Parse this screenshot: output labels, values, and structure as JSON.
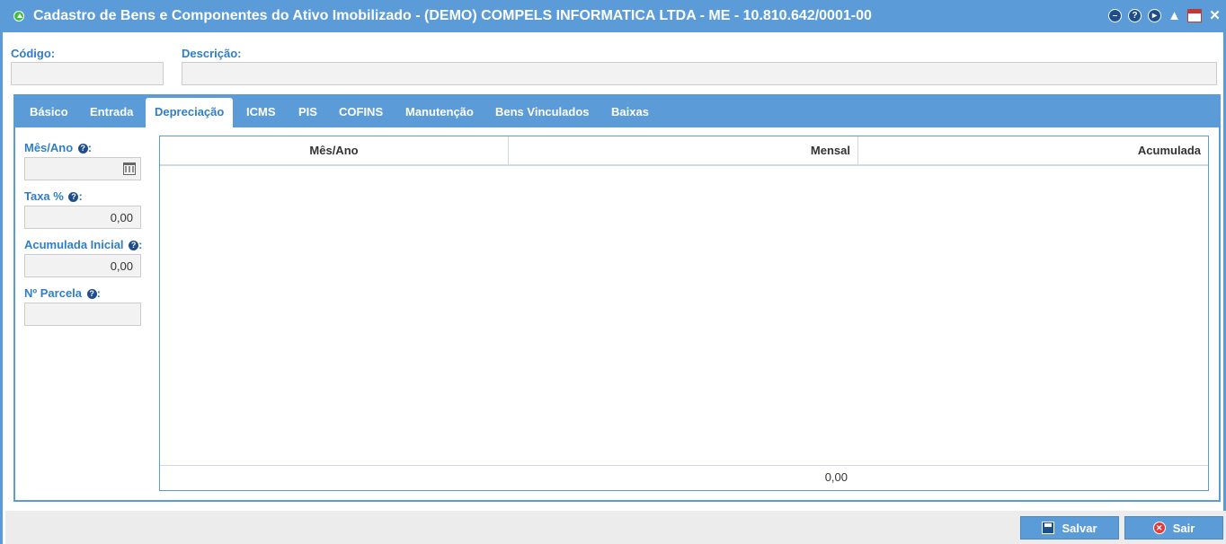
{
  "window": {
    "title": "Cadastro de Bens e Componentes do Ativo Imobilizado - (DEMO) COMPELS INFORMATICA LTDA - ME - 10.810.642/0001-00",
    "accent_color": "#5b9bd8"
  },
  "toolbar_icons": [
    "minimize-icon",
    "help-icon",
    "next-icon",
    "bell-icon",
    "calendar-icon",
    "close-icon"
  ],
  "header": {
    "codigo_label": "Código:",
    "codigo_value": "",
    "descricao_label": "Descrição:",
    "descricao_value": ""
  },
  "tabs": [
    {
      "label": "Básico",
      "active": false
    },
    {
      "label": "Entrada",
      "active": false
    },
    {
      "label": "Depreciação",
      "active": true
    },
    {
      "label": "ICMS",
      "active": false
    },
    {
      "label": "PIS",
      "active": false
    },
    {
      "label": "COFINS",
      "active": false
    },
    {
      "label": "Manutenção",
      "active": false
    },
    {
      "label": "Bens Vinculados",
      "active": false
    },
    {
      "label": "Baixas",
      "active": false
    }
  ],
  "depreciacao": {
    "mes_ano_label": "Mês/Ano",
    "mes_ano_value": "",
    "taxa_label": "Taxa %",
    "taxa_value": "0,00",
    "acumulada_inicial_label": "Acumulada Inicial",
    "acumulada_inicial_value": "0,00",
    "parcela_label": "Nº Parcela",
    "parcela_value": "",
    "help_glyph": "?",
    "colon": ":"
  },
  "grid": {
    "columns": [
      "Mês/Ano",
      "Mensal",
      "Acumulada"
    ],
    "rows": [],
    "footer_total": "0,00"
  },
  "buttons": {
    "save_label": "Salvar",
    "exit_label": "Sair"
  }
}
